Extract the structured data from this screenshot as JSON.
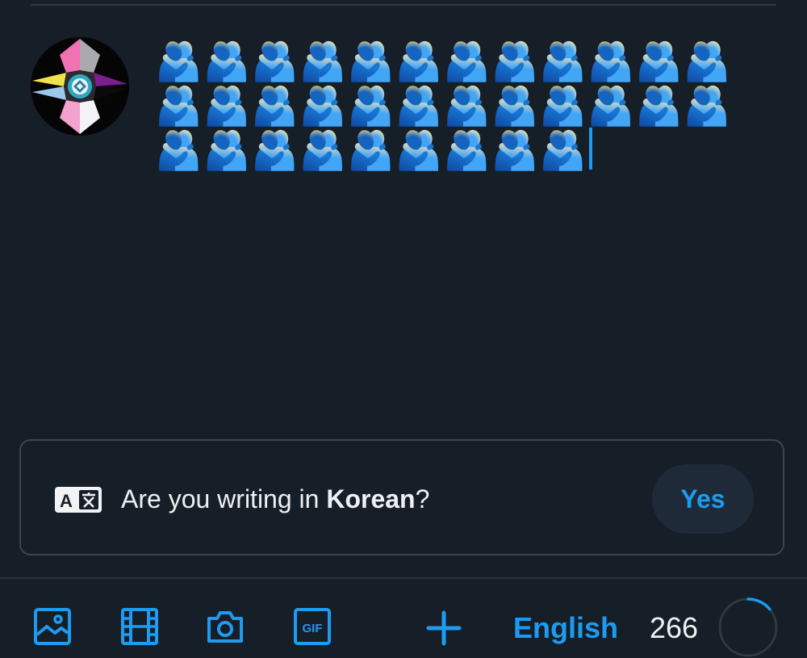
{
  "compose": {
    "text": "🫂🫂🫂🫂🫂🫂🫂🫂🫂🫂🫂🫂🫂🫂🫂🫂🫂🫂🫂🫂🫂🫂🫂🫂🫂🫂🫂🫂🫂🫂🫂🫂🫂"
  },
  "language_prompt": {
    "icon": "translate-icon",
    "prefix": "Are you writing in ",
    "language": "Korean",
    "suffix": "?",
    "yes_label": "Yes"
  },
  "toolbar": {
    "icons": [
      "image-icon",
      "video-icon",
      "camera-icon",
      "gif-icon",
      "plus-icon"
    ],
    "language_label": "English",
    "char_count": "266",
    "progress_fraction": 0.14
  },
  "colors": {
    "accent": "#1d9bf0",
    "background": "#161e27",
    "border": "#3a4652"
  }
}
